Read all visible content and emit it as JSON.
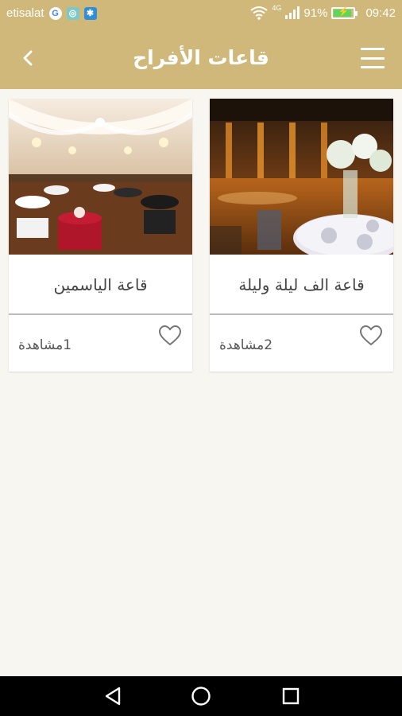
{
  "status_bar": {
    "carrier": "etisalat",
    "network": "4G",
    "battery": "91%",
    "time": "09:42",
    "icons": [
      "google-icon",
      "app-icon",
      "app-icon",
      "wifi-icon",
      "signal-icon",
      "battery-icon"
    ],
    "battery_level": 0.91
  },
  "app_bar": {
    "title": "قاعات الأفراح",
    "back_icon": "chevron-left-icon",
    "menu_icon": "hamburger-menu-icon"
  },
  "halls": [
    {
      "name": "قاعة الف ليلة وليلة",
      "views": "2مشاهدة",
      "favorite_icon": "heart-outline-icon"
    },
    {
      "name": "قاعة الياسمين",
      "views": "1مشاهدة",
      "favorite_icon": "heart-outline-icon"
    }
  ],
  "nav_bar": {
    "icons": [
      "back-triangle-icon",
      "home-circle-icon",
      "recents-square-icon"
    ]
  },
  "colors": {
    "primary": "#cfb87a",
    "background": "#f8f6f1",
    "card": "#ffffff",
    "text": "#444444"
  }
}
